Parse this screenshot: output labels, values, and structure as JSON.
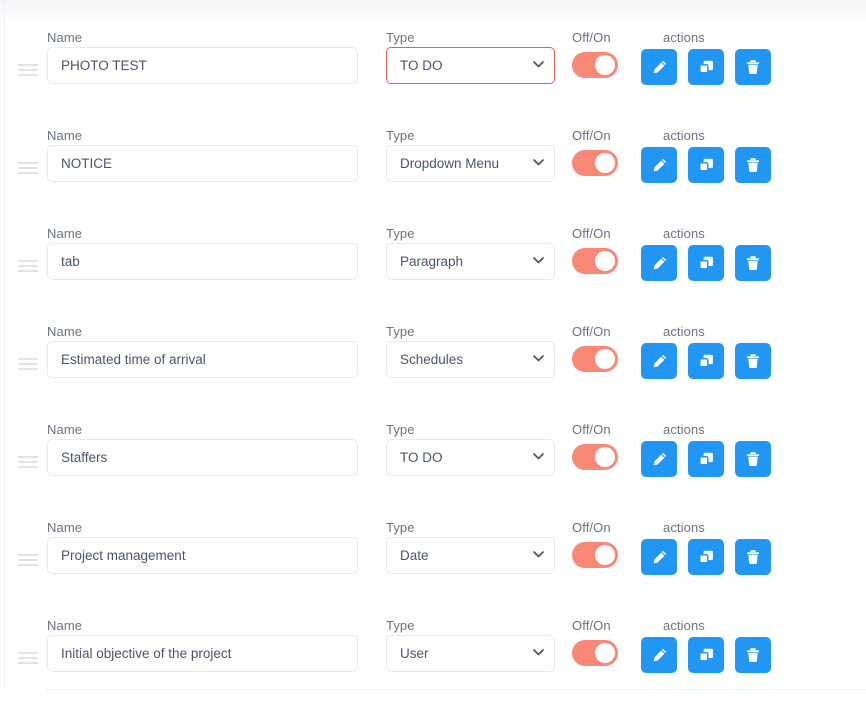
{
  "columns": {
    "name_label": "Name",
    "type_label": "Type",
    "toggle_label": "Off/On",
    "actions_label": "actions"
  },
  "actions": {
    "edit_icon": "pencil-icon",
    "duplicate_icon": "copy-icon",
    "delete_icon": "trash-icon",
    "edit_title": "Edit",
    "duplicate_title": "Duplicate",
    "delete_title": "Delete"
  },
  "colors": {
    "action_button": "#2196f3",
    "toggle_on": "#f98876",
    "focused_select_border": "#e0614a",
    "input_border": "#e8e9ed",
    "label_text": "#6b7280",
    "value_text": "#4a5568"
  },
  "type_options": [
    "TO DO",
    "Dropdown Menu",
    "Paragraph",
    "Schedules",
    "Date",
    "User"
  ],
  "rows": [
    {
      "name_value": "PHOTO TEST",
      "name_placeholder": "Name",
      "type_value": "TO DO",
      "toggle_state": "on",
      "type_focused": true
    },
    {
      "name_value": "NOTICE",
      "name_placeholder": "Name",
      "type_value": "Dropdown Menu",
      "toggle_state": "on",
      "type_focused": false
    },
    {
      "name_value": "tab",
      "name_placeholder": "Name",
      "type_value": "Paragraph",
      "toggle_state": "on",
      "type_focused": false
    },
    {
      "name_value": "Estimated time of arrival",
      "name_placeholder": "Name",
      "type_value": "Schedules",
      "toggle_state": "on",
      "type_focused": false
    },
    {
      "name_value": "Staffers",
      "name_placeholder": "Name",
      "type_value": "TO DO",
      "toggle_state": "on",
      "type_focused": false
    },
    {
      "name_value": "Project management",
      "name_placeholder": "Name",
      "type_value": "Date",
      "toggle_state": "on",
      "type_focused": false
    },
    {
      "name_value": "Initial objective of the project",
      "name_placeholder": "Name",
      "type_value": "User",
      "toggle_state": "on",
      "type_focused": false
    }
  ]
}
